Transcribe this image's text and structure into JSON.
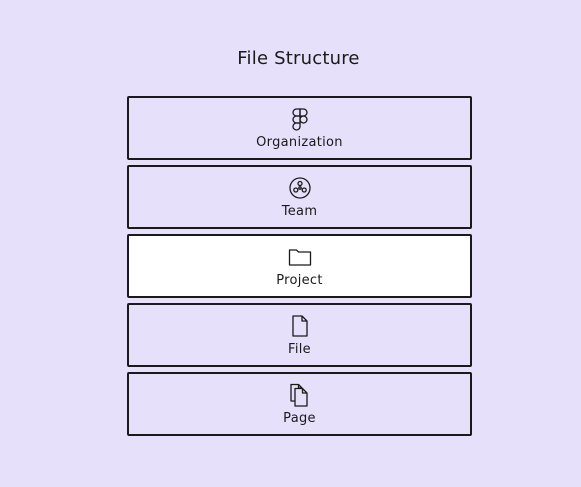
{
  "diagram": {
    "title": "File Structure",
    "levels": [
      {
        "label": "Organization",
        "icon": "figma-logo-icon",
        "highlighted": false
      },
      {
        "label": "Team",
        "icon": "team-icon",
        "highlighted": false
      },
      {
        "label": "Project",
        "icon": "folder-icon",
        "highlighted": true
      },
      {
        "label": "File",
        "icon": "file-icon",
        "highlighted": false
      },
      {
        "label": "Page",
        "icon": "pages-icon",
        "highlighted": false
      }
    ]
  },
  "colors": {
    "background": "#e6e0fb",
    "highlight": "#ffffff",
    "stroke": "#1a1a1a"
  }
}
